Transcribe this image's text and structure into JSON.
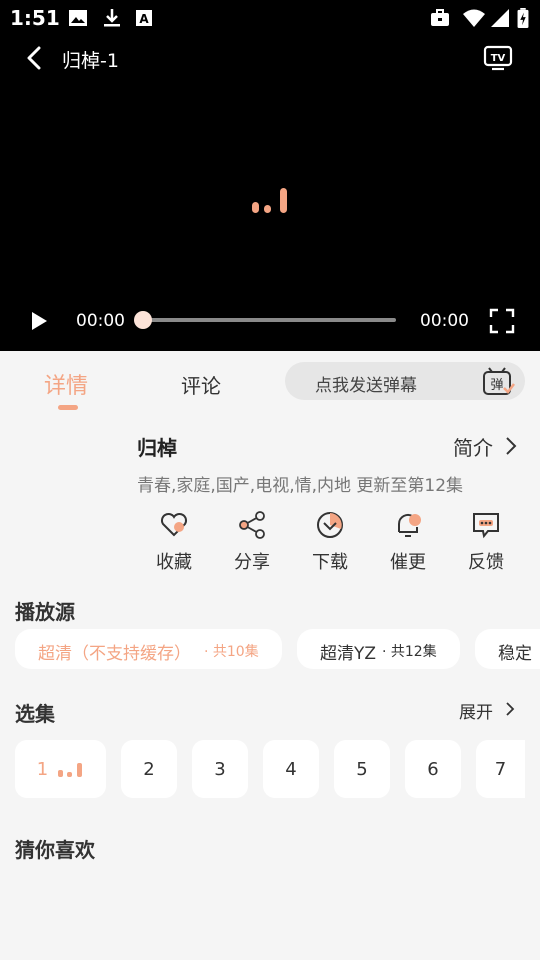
{
  "status_bar": {
    "time": "1:51"
  },
  "player": {
    "title": "归棹-1",
    "current_time": "00:00",
    "total_time": "00:00",
    "progress": 0
  },
  "tabs": {
    "details": "详情",
    "comments": "评论",
    "active": "details"
  },
  "danmaku": {
    "placeholder": "点我发送弹幕",
    "icon_text": "弹"
  },
  "info": {
    "title": "归棹",
    "intro_label": "简介",
    "meta": "青春,家庭,国产,电视,情,内地 更新至第12集"
  },
  "actions": [
    {
      "label": "收藏",
      "icon": "heart-icon"
    },
    {
      "label": "分享",
      "icon": "share-icon"
    },
    {
      "label": "下载",
      "icon": "download-icon"
    },
    {
      "label": "催更",
      "icon": "bell-icon"
    },
    {
      "label": "反馈",
      "icon": "feedback-icon"
    }
  ],
  "sources": {
    "title": "播放源",
    "items": [
      {
        "name": "超清（不支持缓存）",
        "count": "· 共10集",
        "selected": true
      },
      {
        "name": "超清YZ",
        "count": "· 共12集",
        "selected": false
      },
      {
        "name": "稳定",
        "count": "",
        "selected": false
      }
    ]
  },
  "episodes": {
    "title": "选集",
    "expand_label": "展开",
    "items": [
      "1",
      "2",
      "3",
      "4",
      "5",
      "6",
      "7"
    ],
    "current": "1"
  },
  "recommend": {
    "title": "猜你喜欢"
  },
  "colors": {
    "accent": "#f4a584",
    "player_bg": "#000000",
    "page_bg": "#f5f5f5"
  }
}
